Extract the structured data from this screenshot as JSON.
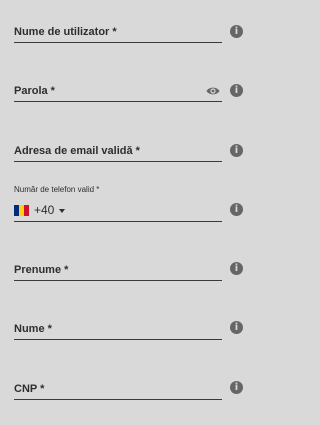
{
  "fields": {
    "username": {
      "label": "Nume de utilizator *"
    },
    "password": {
      "label": "Parola *"
    },
    "email": {
      "label": "Adresa de email validă *"
    },
    "phone": {
      "label": "Număr de telefon valid *",
      "country_code": "+40",
      "flag_colors": [
        "#002b7f",
        "#fcd116",
        "#ce1126"
      ]
    },
    "first_name": {
      "label": "Prenume *"
    },
    "last_name": {
      "label": "Nume *"
    },
    "cnp": {
      "label": "CNP *"
    }
  },
  "info_icon_glyph": "i",
  "icons": {
    "info": "info-icon",
    "password_toggle": "eye-icon",
    "dropdown": "caret-down-icon",
    "flag": "romania-flag-icon"
  }
}
